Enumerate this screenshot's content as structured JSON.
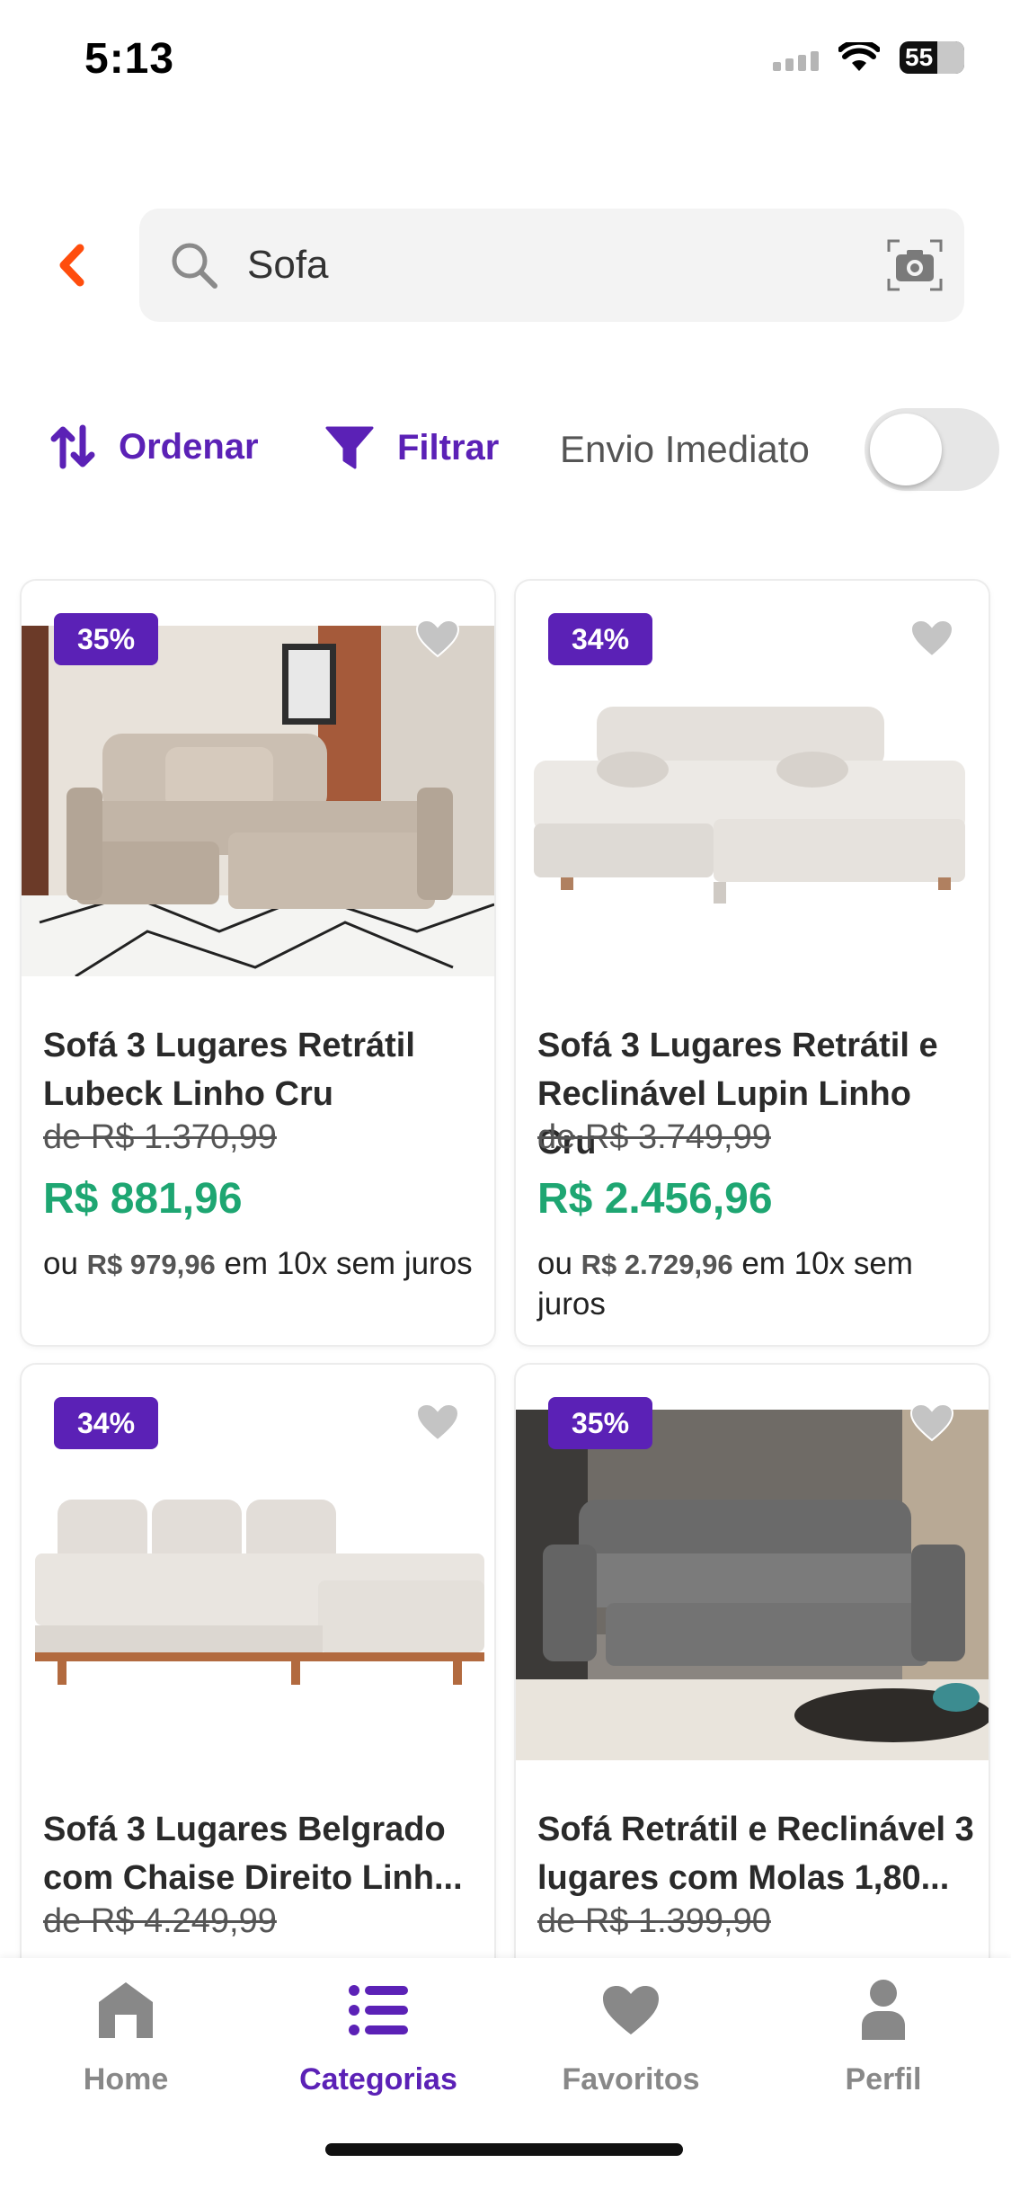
{
  "status_bar": {
    "time": "5:13",
    "battery": "55"
  },
  "search": {
    "query": "Sofa"
  },
  "filters": {
    "sort_label": "Ordenar",
    "filter_label": "Filtrar",
    "envio_label": "Envio Imediato",
    "envio_enabled": false
  },
  "products": [
    {
      "discount": "35%",
      "title_line1": "Sofá 3 Lugares Retrátil",
      "title_line2": "Lubeck Linho Cru",
      "old_price": "de R$ 1.370,99",
      "price": "R$ 881,96",
      "inst_prefix": "ou",
      "inst_amount": "R$ 979,96",
      "inst_suffix": "em 10x sem juros"
    },
    {
      "discount": "34%",
      "title_line1": "Sofá 3 Lugares Retrátil e",
      "title_line2": "Reclinável Lupin Linho Cru",
      "old_price": "de R$ 3.749,99",
      "price": "R$ 2.456,96",
      "inst_prefix": "ou",
      "inst_amount": "R$ 2.729,96",
      "inst_suffix": "em 10x sem juros"
    },
    {
      "discount": "34%",
      "title_line1": "Sofá 3 Lugares Belgrado",
      "title_line2": "com Chaise Direito Linh...",
      "old_price": "de R$ 4.249,99"
    },
    {
      "discount": "35%",
      "title_line1": "Sofá Retrátil e Reclinável 3",
      "title_line2": "lugares com Molas 1,80...",
      "old_price": "de R$ 1.399,90"
    }
  ],
  "tabs": [
    {
      "label": "Home",
      "icon": "home-icon"
    },
    {
      "label": "Categorias",
      "icon": "list-icon",
      "active": true
    },
    {
      "label": "Favoritos",
      "icon": "heart-icon"
    },
    {
      "label": "Perfil",
      "icon": "person-icon"
    }
  ],
  "colors": {
    "accent": "#5b21b6",
    "price": "#1ea672",
    "back": "#ff4d0d"
  }
}
